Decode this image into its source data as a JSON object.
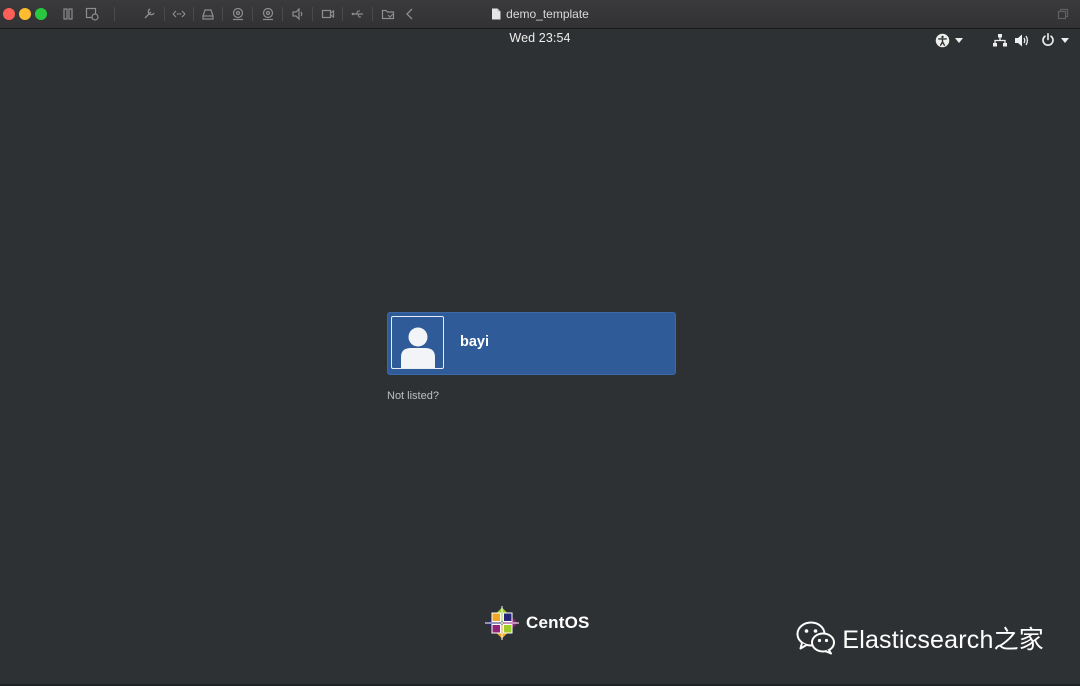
{
  "host_window": {
    "title": "demo_template",
    "toolbar_icons": [
      "pause-icon",
      "snapshot-icon",
      "settings-wrench-icon",
      "network-arrows-icon",
      "hard-disk-icon",
      "camera-icon",
      "camera-icon",
      "sound-icon",
      "video-camera-icon",
      "usb-icon",
      "shared-folder-icon",
      "back-chevron-icon"
    ]
  },
  "panel": {
    "clock": "Wed 23:54",
    "icons": [
      "accessibility-icon",
      "network-icon",
      "volume-icon",
      "power-icon"
    ]
  },
  "login": {
    "users": [
      {
        "name": "bayi"
      }
    ],
    "not_listed": "Not listed?"
  },
  "branding": {
    "distro_logo_text": "CentOS",
    "watermark_text": "Elasticsearch之家"
  },
  "colors": {
    "background": "#2e3133",
    "selected_user": "#2f5c98",
    "close": "#fe5f57",
    "minimize": "#febc2e",
    "maximize": "#28c840"
  }
}
